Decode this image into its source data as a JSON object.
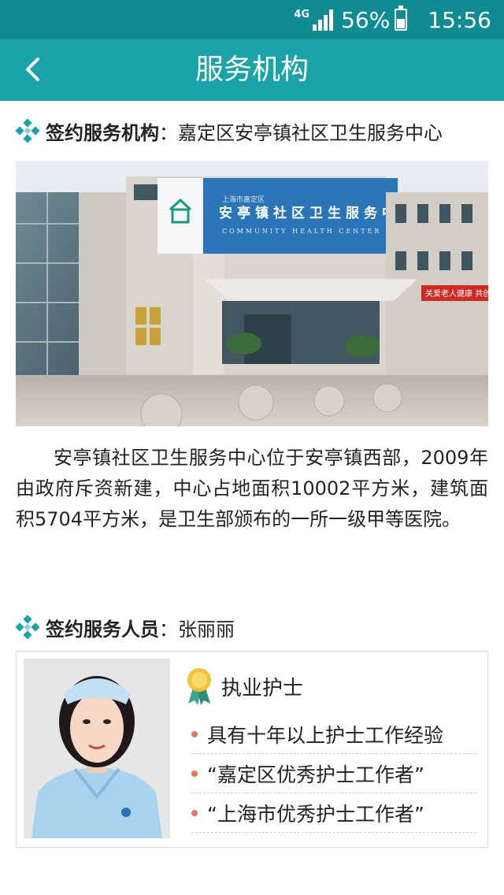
{
  "status_bar": {
    "network": "4G",
    "battery": "56%",
    "time": "15:56"
  },
  "nav": {
    "back_icon": "chevron-left-icon",
    "title": "服务机构"
  },
  "institution": {
    "label": "签约服务机构",
    "value": "：嘉定区安亭镇社区卫生服务中心",
    "photo": {
      "sign_small": "上海市嘉定区",
      "sign_main": "安亭镇社区卫生服务中心",
      "sign_english": "COMMUNITY HEALTH CENTER",
      "banner": "关爱老人健康  共创"
    },
    "description": "安亭镇社区卫生服务中心位于安亭镇西部，2009年由政府斥资新建，中心占地面积10002平方米，建筑面积5704平方米，是卫生部颁布的一所一级甲等医院。"
  },
  "staff": {
    "label": "签约服务人员",
    "value": "：张丽丽",
    "title": "执业护士",
    "qualifications": [
      "具有十年以上护士工作经验",
      "“嘉定区优秀护士工作者”",
      "“上海市优秀护士工作者”"
    ]
  },
  "colors": {
    "status_bar": "#0f8c92",
    "nav_bar": "#1aa3a8",
    "bullet": "#e8745a"
  }
}
